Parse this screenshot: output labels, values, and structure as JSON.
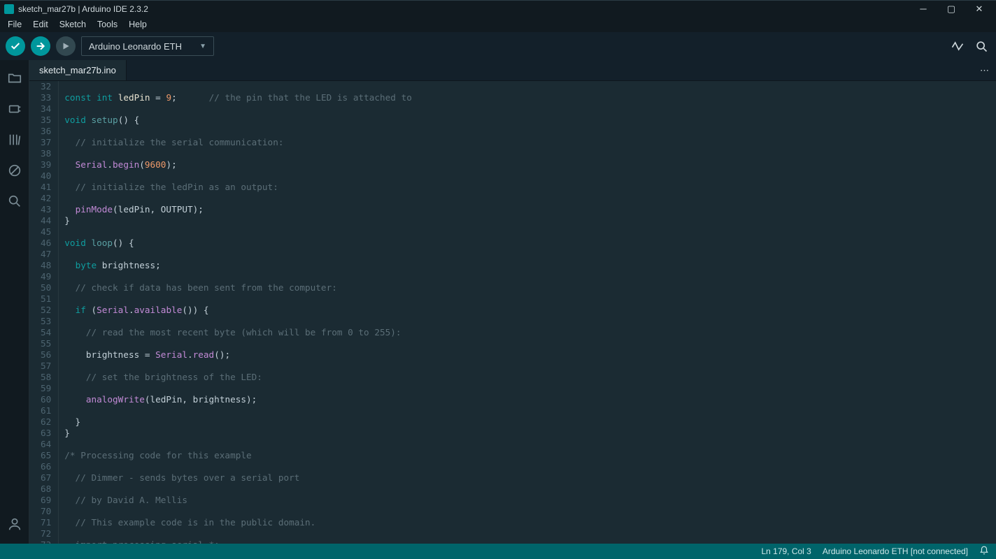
{
  "window": {
    "title": "sketch_mar27b | Arduino IDE 2.3.2"
  },
  "menubar": {
    "items": [
      "File",
      "Edit",
      "Sketch",
      "Tools",
      "Help"
    ]
  },
  "toolbar": {
    "board_selected": "Arduino Leonardo ETH"
  },
  "tabs": {
    "active": "sketch_mar27b.ino"
  },
  "editor": {
    "first_line_no": 32,
    "lines": [
      "",
      {
        "segs": [
          {
            "t": "const ",
            "c": "tok-kw"
          },
          {
            "t": "int ",
            "c": "tok-type"
          },
          {
            "t": "ledPin",
            "c": "tok-id"
          },
          {
            "t": " = ",
            "c": "tok-op"
          },
          {
            "t": "9",
            "c": "tok-num"
          },
          {
            "t": ";      ",
            "c": "tok-op"
          },
          {
            "t": "// the pin that the LED is attached to",
            "c": "tok-comment"
          }
        ]
      },
      "",
      {
        "segs": [
          {
            "t": "void ",
            "c": "tok-kw"
          },
          {
            "t": "setup",
            "c": "tok-func"
          },
          {
            "t": "() {",
            "c": "tok-op"
          }
        ]
      },
      "",
      {
        "segs": [
          {
            "t": "  ",
            "c": "tok-op"
          },
          {
            "t": "// initialize the serial communication:",
            "c": "tok-comment"
          }
        ]
      },
      "",
      {
        "segs": [
          {
            "t": "  ",
            "c": "tok-op"
          },
          {
            "t": "Serial",
            "c": "tok-obj"
          },
          {
            "t": ".",
            "c": "tok-op"
          },
          {
            "t": "begin",
            "c": "tok-funccall"
          },
          {
            "t": "(",
            "c": "tok-op"
          },
          {
            "t": "9600",
            "c": "tok-num"
          },
          {
            "t": ");",
            "c": "tok-op"
          }
        ]
      },
      "",
      {
        "segs": [
          {
            "t": "  ",
            "c": "tok-op"
          },
          {
            "t": "// initialize the ledPin as an output:",
            "c": "tok-comment"
          }
        ]
      },
      "",
      {
        "segs": [
          {
            "t": "  ",
            "c": "tok-op"
          },
          {
            "t": "pinMode",
            "c": "tok-funccall"
          },
          {
            "t": "(ledPin, OUTPUT);",
            "c": "tok-op"
          }
        ]
      },
      {
        "segs": [
          {
            "t": "}",
            "c": "tok-op"
          }
        ]
      },
      "",
      {
        "segs": [
          {
            "t": "void ",
            "c": "tok-kw"
          },
          {
            "t": "loop",
            "c": "tok-func"
          },
          {
            "t": "() {",
            "c": "tok-op"
          }
        ]
      },
      "",
      {
        "segs": [
          {
            "t": "  ",
            "c": "tok-op"
          },
          {
            "t": "byte",
            "c": "tok-type"
          },
          {
            "t": " brightness;",
            "c": "tok-op"
          }
        ]
      },
      "",
      {
        "segs": [
          {
            "t": "  ",
            "c": "tok-op"
          },
          {
            "t": "// check if data has been sent from the computer:",
            "c": "tok-comment"
          }
        ]
      },
      "",
      {
        "segs": [
          {
            "t": "  ",
            "c": "tok-op"
          },
          {
            "t": "if",
            "c": "tok-kw"
          },
          {
            "t": " (",
            "c": "tok-op"
          },
          {
            "t": "Serial",
            "c": "tok-obj"
          },
          {
            "t": ".",
            "c": "tok-op"
          },
          {
            "t": "available",
            "c": "tok-funccall"
          },
          {
            "t": "()) {",
            "c": "tok-op"
          }
        ]
      },
      "",
      {
        "segs": [
          {
            "t": "    ",
            "c": "tok-op"
          },
          {
            "t": "// read the most recent byte (which will be from 0 to 255):",
            "c": "tok-comment"
          }
        ]
      },
      "",
      {
        "segs": [
          {
            "t": "    brightness = ",
            "c": "tok-op"
          },
          {
            "t": "Serial",
            "c": "tok-obj"
          },
          {
            "t": ".",
            "c": "tok-op"
          },
          {
            "t": "read",
            "c": "tok-funccall"
          },
          {
            "t": "();",
            "c": "tok-op"
          }
        ]
      },
      "",
      {
        "segs": [
          {
            "t": "    ",
            "c": "tok-op"
          },
          {
            "t": "// set the brightness of the LED:",
            "c": "tok-comment"
          }
        ]
      },
      "",
      {
        "segs": [
          {
            "t": "    ",
            "c": "tok-op"
          },
          {
            "t": "analogWrite",
            "c": "tok-funccall"
          },
          {
            "t": "(ledPin, brightness);",
            "c": "tok-op"
          }
        ]
      },
      "",
      {
        "segs": [
          {
            "t": "  }",
            "c": "tok-op"
          }
        ]
      },
      {
        "segs": [
          {
            "t": "}",
            "c": "tok-op"
          }
        ]
      },
      "",
      {
        "segs": [
          {
            "t": "/* Processing code for this example",
            "c": "tok-comment"
          }
        ]
      },
      "",
      {
        "segs": [
          {
            "t": "  // Dimmer - sends bytes over a serial port",
            "c": "tok-comment"
          }
        ]
      },
      "",
      {
        "segs": [
          {
            "t": "  // by David A. Mellis",
            "c": "tok-comment"
          }
        ]
      },
      "",
      {
        "segs": [
          {
            "t": "  // This example code is in the public domain.",
            "c": "tok-comment"
          }
        ]
      },
      "",
      {
        "segs": [
          {
            "t": "  import processing.serial.*;",
            "c": "tok-comment"
          }
        ]
      },
      ""
    ]
  },
  "statusbar": {
    "cursor": "Ln 179, Col 3",
    "board": "Arduino Leonardo ETH [not connected]"
  }
}
